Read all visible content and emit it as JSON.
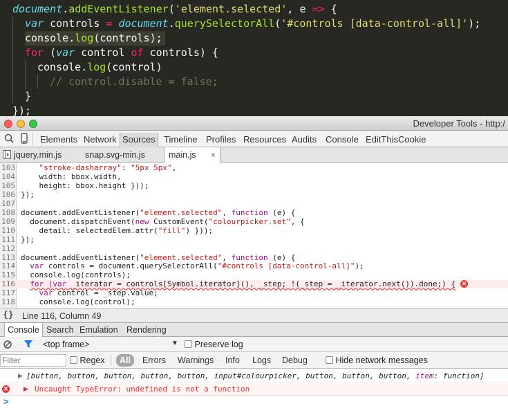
{
  "editor": {
    "lines": [
      {
        "indent": 0,
        "tokens": [
          {
            "t": "document",
            "c": "tk-it"
          },
          {
            "t": ".",
            "c": "tk-pl"
          },
          {
            "t": "addEventListener",
            "c": "tk-fn"
          },
          {
            "t": "(",
            "c": "tk-pl"
          },
          {
            "t": "'element.selected'",
            "c": "tk-str"
          },
          {
            "t": ", ",
            "c": "tk-pl"
          },
          {
            "t": "e",
            "c": "tk-pl"
          },
          {
            "t": " ",
            "c": "tk-pl"
          },
          {
            "t": "=>",
            "c": "tk-kw"
          },
          {
            "t": " {",
            "c": "tk-pl"
          }
        ]
      },
      {
        "indent": 1,
        "tokens": [
          {
            "t": "var",
            "c": "tk-it"
          },
          {
            "t": " controls ",
            "c": "tk-pl"
          },
          {
            "t": "=",
            "c": "tk-kw"
          },
          {
            "t": " ",
            "c": "tk-pl"
          },
          {
            "t": "document",
            "c": "tk-it"
          },
          {
            "t": ".",
            "c": "tk-pl"
          },
          {
            "t": "querySelectorAll",
            "c": "tk-fn"
          },
          {
            "t": "(",
            "c": "tk-pl"
          },
          {
            "t": "'#controls [data-control-all]'",
            "c": "tk-str"
          },
          {
            "t": ");",
            "c": "tk-pl"
          }
        ]
      },
      {
        "indent": 1,
        "hl": true,
        "tokens": [
          {
            "t": "console",
            "c": "tk-pl"
          },
          {
            "t": ".",
            "c": "tk-pl"
          },
          {
            "t": "log",
            "c": "tk-fn"
          },
          {
            "t": "(controls);",
            "c": "tk-pl"
          }
        ]
      },
      {
        "indent": 1,
        "tokens": [
          {
            "t": "for",
            "c": "tk-kw"
          },
          {
            "t": " (",
            "c": "tk-pl"
          },
          {
            "t": "var",
            "c": "tk-it"
          },
          {
            "t": " control ",
            "c": "tk-pl"
          },
          {
            "t": "of",
            "c": "tk-kw"
          },
          {
            "t": " controls) {",
            "c": "tk-pl"
          }
        ]
      },
      {
        "indent": 2,
        "tokens": [
          {
            "t": "console",
            "c": "tk-pl"
          },
          {
            "t": ".",
            "c": "tk-pl"
          },
          {
            "t": "log",
            "c": "tk-fn"
          },
          {
            "t": "(control)",
            "c": "tk-pl"
          }
        ]
      },
      {
        "indent": 3,
        "tokens": [
          {
            "t": "// control.disable = false;",
            "c": "tk-cm"
          }
        ]
      },
      {
        "indent": 1,
        "tokens": [
          {
            "t": "}",
            "c": "tk-pl"
          }
        ]
      },
      {
        "indent": 0,
        "tokens": [
          {
            "t": "});",
            "c": "tk-pl"
          }
        ]
      }
    ]
  },
  "window": {
    "title": "Developer Tools - http:/"
  },
  "panels": [
    "Elements",
    "Network",
    "Sources",
    "Timeline",
    "Profiles",
    "Resources",
    "Audits",
    "Console",
    "EditThisCookie"
  ],
  "active_panel": "Sources",
  "file_tabs": [
    "jquery.min.js",
    "snap.svg-min.js",
    "main.js"
  ],
  "active_file": "main.js",
  "source_lines": [
    {
      "n": "103",
      "segs": [
        {
          "t": "    "
        },
        {
          "t": "\"stroke-dasharray\"",
          "c": "c-str"
        },
        {
          "t": ": "
        },
        {
          "t": "\"5px 5px\"",
          "c": "c-str"
        },
        {
          "t": ","
        }
      ]
    },
    {
      "n": "104",
      "segs": [
        {
          "t": "    width: bbox.width,"
        }
      ]
    },
    {
      "n": "105",
      "segs": [
        {
          "t": "    height: bbox.height }));"
        }
      ]
    },
    {
      "n": "106",
      "segs": [
        {
          "t": "});"
        }
      ]
    },
    {
      "n": "107",
      "segs": []
    },
    {
      "n": "108",
      "segs": [
        {
          "t": "document.addEventListener("
        },
        {
          "t": "\"element.selected\"",
          "c": "c-str"
        },
        {
          "t": ", "
        },
        {
          "t": "function",
          "c": "c-kw"
        },
        {
          "t": " (e) {"
        }
      ]
    },
    {
      "n": "109",
      "segs": [
        {
          "t": "  document.dispatchEvent("
        },
        {
          "t": "new",
          "c": "c-kw"
        },
        {
          "t": " CustomEvent("
        },
        {
          "t": "\"colourpicker.set\"",
          "c": "c-str"
        },
        {
          "t": ", {"
        }
      ]
    },
    {
      "n": "110",
      "segs": [
        {
          "t": "    detail: selectedElem.attr("
        },
        {
          "t": "\"fill\"",
          "c": "c-str"
        },
        {
          "t": ") }));"
        }
      ]
    },
    {
      "n": "111",
      "segs": [
        {
          "t": "});"
        }
      ]
    },
    {
      "n": "112",
      "segs": []
    },
    {
      "n": "113",
      "segs": [
        {
          "t": "document.addEventListener("
        },
        {
          "t": "\"element.selected\"",
          "c": "c-str"
        },
        {
          "t": ", "
        },
        {
          "t": "function",
          "c": "c-kw"
        },
        {
          "t": " (e) {"
        }
      ]
    },
    {
      "n": "114",
      "segs": [
        {
          "t": "  "
        },
        {
          "t": "var",
          "c": "c-kw"
        },
        {
          "t": " controls = document.querySelectorAll("
        },
        {
          "t": "\"#controls [data-control-all]\"",
          "c": "c-str"
        },
        {
          "t": ");"
        }
      ]
    },
    {
      "n": "115",
      "segs": [
        {
          "t": "  console.log(controls);"
        }
      ]
    },
    {
      "n": "116",
      "err": true,
      "segs": [
        {
          "t": "  "
        },
        {
          "t": "for (",
          "c": "c-kw squig"
        },
        {
          "t": "var",
          "c": "c-kw squig"
        },
        {
          "t": " _iterator = controls[Symbol.iterator](), _step; !(_step = _iterator.next()).done;) {",
          "c": "squig"
        }
      ]
    },
    {
      "n": "117",
      "segs": [
        {
          "t": "    "
        },
        {
          "t": "var",
          "c": "c-kw"
        },
        {
          "t": " control = _step.value;"
        }
      ]
    },
    {
      "n": "118",
      "segs": [
        {
          "t": "    console.log(control);"
        }
      ]
    }
  ],
  "status": {
    "position": "Line 116, Column 49"
  },
  "drawer_tabs": [
    "Console",
    "Search",
    "Emulation",
    "Rendering"
  ],
  "active_drawer": "Console",
  "frame_select": "<top frame>",
  "preserve_log": "Preserve log",
  "filter": {
    "placeholder": "Filter",
    "regex": "Regex",
    "levels": [
      "All",
      "Errors",
      "Warnings",
      "Info",
      "Logs",
      "Debug"
    ],
    "active_level": "All",
    "hide_network": "Hide network messages"
  },
  "console": {
    "log_line": {
      "open": "[",
      "items": [
        "button",
        "button",
        "button",
        "button",
        "button",
        "input#colourpicker",
        "button",
        "button",
        "button"
      ],
      "tail_key": "item",
      "tail_val": "function",
      "close": "]"
    },
    "error": "Uncaught TypeError: undefined is not a function",
    "prompt": ">"
  },
  "colors": {
    "error": "#e33",
    "selection": "#3e3d32",
    "accent_blue": "#1a7ae8",
    "active_chip": "#a5a5a5"
  }
}
